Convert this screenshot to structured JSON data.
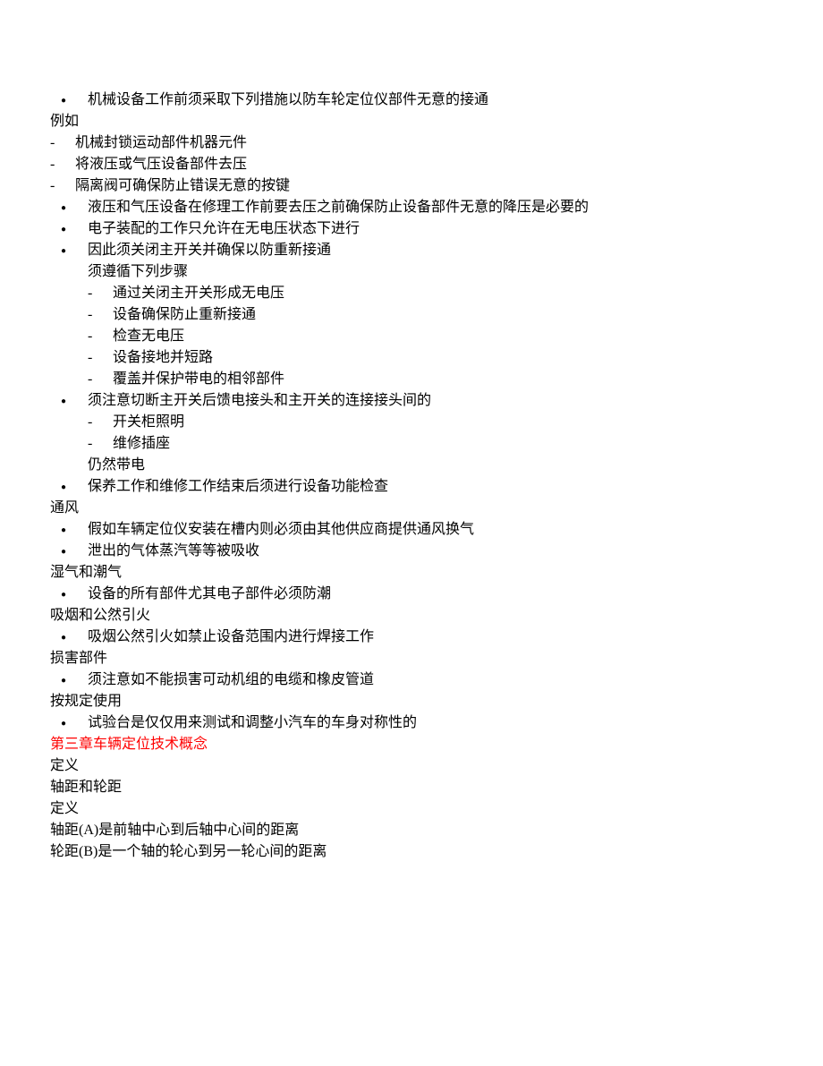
{
  "lines": [
    {
      "cls": "bullet-filled",
      "text": "机械设备工作前须采取下列措施以防车轮定位仪部件无意的接通"
    },
    {
      "cls": "no-indent",
      "text": "例如"
    },
    {
      "cls": "dash-1",
      "text": "机械封锁运动部件机器元件"
    },
    {
      "cls": "dash-1",
      "text": "将液压或气压设备部件去压"
    },
    {
      "cls": "dash-1",
      "text": "隔离阀可确保防止错误无意的按键"
    },
    {
      "cls": "bullet-filled",
      "text": "液压和气压设备在修理工作前要去压之前确保防止设备部件无意的降压是必要的"
    },
    {
      "cls": "bullet-filled",
      "text": "电子装配的工作只允许在无电压状态下进行"
    },
    {
      "cls": "bullet-filled",
      "text": "因此须关闭主开关并确保以防重新接通"
    },
    {
      "cls": "indent-1",
      "text": "须遵循下列步骤"
    },
    {
      "cls": "dash-2",
      "text": "通过关闭主开关形成无电压"
    },
    {
      "cls": "dash-2",
      "text": "设备确保防止重新接通"
    },
    {
      "cls": "dash-2",
      "text": "检查无电压"
    },
    {
      "cls": "dash-2",
      "text": "设备接地并短路"
    },
    {
      "cls": "dash-2",
      "text": "覆盖并保护带电的相邻部件"
    },
    {
      "cls": "bullet-filled",
      "text": "须注意切断主开关后馈电接头和主开关的连接接头间的"
    },
    {
      "cls": "dash-2",
      "text": "开关柜照明"
    },
    {
      "cls": "dash-2",
      "text": "维修插座"
    },
    {
      "cls": "indent-1",
      "text": "仍然带电"
    },
    {
      "cls": "bullet-filled",
      "text": "保养工作和维修工作结束后须进行设备功能检查"
    },
    {
      "cls": "no-indent",
      "text": "通风"
    },
    {
      "cls": "bullet-filled",
      "text": "假如车辆定位仪安装在槽内则必须由其他供应商提供通风换气"
    },
    {
      "cls": "bullet-filled",
      "text": "泄出的气体蒸汽等等被吸收"
    },
    {
      "cls": "no-indent",
      "text": "湿气和潮气"
    },
    {
      "cls": "bullet-filled",
      "text": "设备的所有部件尤其电子部件必须防潮"
    },
    {
      "cls": "no-indent",
      "text": "吸烟和公然引火"
    },
    {
      "cls": "bullet-filled",
      "text": "吸烟公然引火如禁止设备范围内进行焊接工作"
    },
    {
      "cls": "no-indent",
      "text": "损害部件"
    },
    {
      "cls": "bullet-filled",
      "text": "须注意如不能损害可动机组的电缆和橡皮管道"
    },
    {
      "cls": "no-indent",
      "text": "按规定使用"
    },
    {
      "cls": "bullet-filled",
      "text": "试验台是仅仅用来测试和调整小汽车的车身对称性的"
    },
    {
      "cls": "no-indent red",
      "text": "第三章车辆定位技术概念"
    },
    {
      "cls": "no-indent",
      "text": "定义"
    },
    {
      "cls": "no-indent",
      "text": "轴距和轮距"
    },
    {
      "cls": "no-indent",
      "text": "定义"
    },
    {
      "cls": "no-indent",
      "text": "轴距(A)是前轴中心到后轴中心间的距离"
    },
    {
      "cls": "no-indent",
      "text": "轮距(B)是一个轴的轮心到另一轮心间的距离"
    }
  ]
}
